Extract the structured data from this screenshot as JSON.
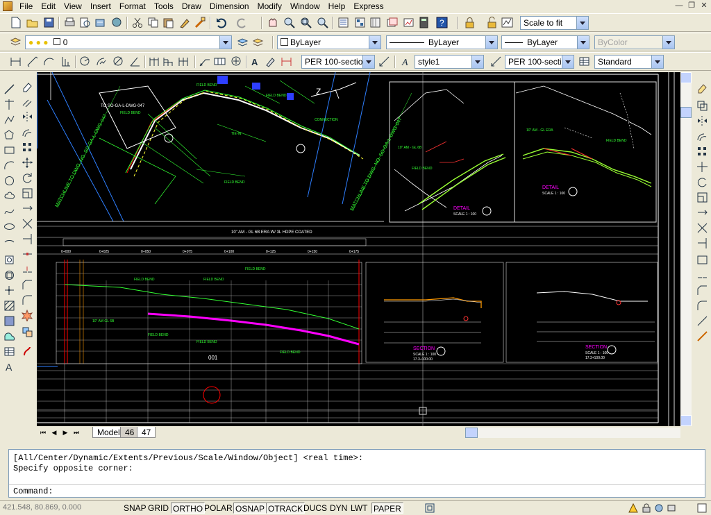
{
  "menu": [
    "File",
    "Edit",
    "View",
    "Insert",
    "Format",
    "Tools",
    "Draw",
    "Dimension",
    "Modify",
    "Window",
    "Help",
    "Express"
  ],
  "toolbar_standard": {
    "named_view_combo": "Scale to fit"
  },
  "toolbar_layers": {
    "layer_combo": "0",
    "color_combo": "ByLayer",
    "linetype_combo": "ByLayer",
    "lineweight_combo": "ByLayer",
    "plotstyle_combo": "ByColor"
  },
  "toolbar_dims": {
    "dimstyle_combo": "PER 100-sectio",
    "textstyle_combo": "style1",
    "dimstyle2_combo": "PER 100-sectio",
    "tablestyle_combo": "Standard"
  },
  "layout_tabs": {
    "model": "Model",
    "tab46": "46",
    "tab47": "47"
  },
  "command_line": {
    "line1": "[All/Center/Dynamic/Extents/Previous/Scale/Window/Object] <real time>:",
    "line2": "Specify opposite corner:",
    "prompt": "Command:"
  },
  "status": {
    "coordinates": "421.548, 80.869, 0.000",
    "buttons": [
      "SNAP",
      "GRID",
      "ORTHO",
      "POLAR",
      "OSNAP",
      "OTRACK",
      "DUCS",
      "DYN",
      "LWT",
      "PAPER"
    ]
  },
  "drawing": {
    "profile_title": "10\" AM - GL 6B ERA W/ 3L HDPE COATED",
    "stations": [
      "0+000",
      "0+025",
      "0+050",
      "0+075",
      "0+100",
      "0+125",
      "0+150",
      "0+175"
    ],
    "match_lines": [
      "MATCHLINE TO DWG. NO. SO-GA-L-DWG-047",
      "MATCHLINE TO DWG. NO. SO-GA-L-DWG-047"
    ],
    "detail_labels": [
      "DETAIL",
      "DETAIL",
      "SECTION",
      "SECTION"
    ],
    "detail_scale": [
      "SCALE 1 : 100",
      "SCALE 1 : 100"
    ],
    "section_scale": [
      "SCALE 1 : 100",
      "SCALE 1 : 100"
    ],
    "section_ref": [
      "17.3+100.00",
      "17.3+100.00"
    ],
    "profile_num": "001"
  },
  "icons_colors": {
    "accent": "#ece9d8",
    "canvas": "#000000"
  }
}
